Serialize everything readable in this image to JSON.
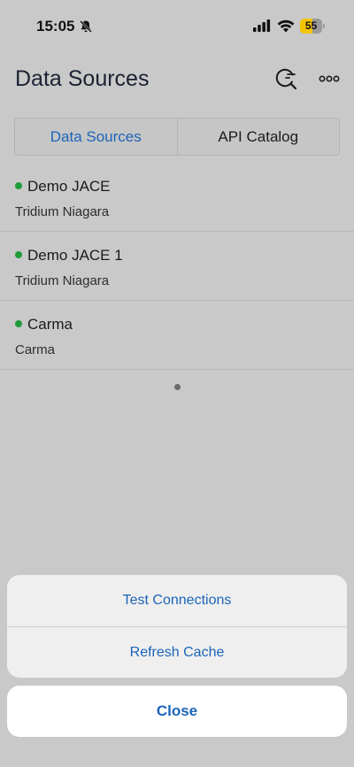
{
  "status_bar": {
    "time": "15:05",
    "battery_level": "55",
    "battery_fraction": 0.55,
    "icons": [
      "bell-slash-icon",
      "signal-icon",
      "wifi-icon",
      "battery-icon"
    ]
  },
  "header": {
    "title": "Data Sources",
    "search_icon": "search-icon",
    "more_icon": "more-icon"
  },
  "tabs": [
    {
      "label": "Data Sources",
      "active": true
    },
    {
      "label": "API Catalog",
      "active": false
    }
  ],
  "data_sources": [
    {
      "name": "Demo JACE",
      "type": "Tridium Niagara",
      "status": "online"
    },
    {
      "name": "Demo JACE 1",
      "type": "Tridium Niagara",
      "status": "online"
    },
    {
      "name": "Carma",
      "type": "Carma",
      "status": "online"
    }
  ],
  "action_sheet": {
    "actions": [
      {
        "label": "Test Connections"
      },
      {
        "label": "Refresh Cache"
      }
    ],
    "close_label": "Close"
  },
  "colors": {
    "accent": "#1c64b8",
    "status_online": "#1f9b3a",
    "battery": "#f4c400"
  }
}
